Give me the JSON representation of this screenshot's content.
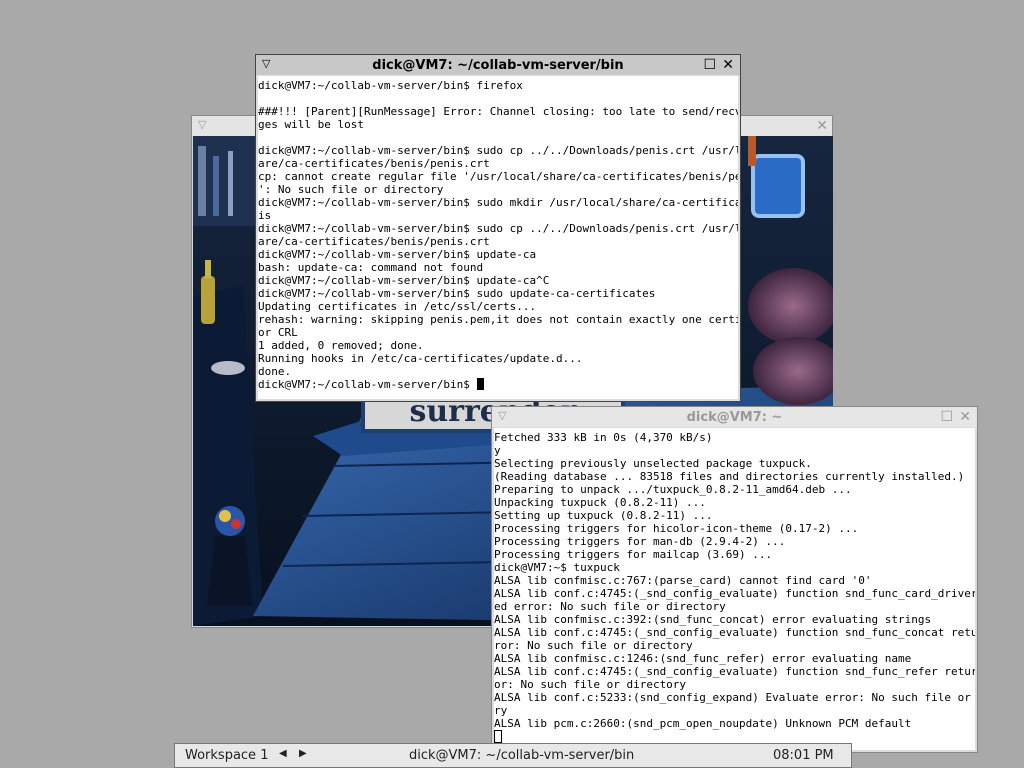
{
  "game_window": {
    "menu_icon": "chevron-down-icon",
    "close_icon": "close-icon",
    "scene_text": "surrender"
  },
  "terminal1": {
    "title": "dick@VM7: ~/collab-vm-server/bin",
    "menu_icon": "chevron-down-icon",
    "maximize_icon": "square-icon",
    "close_icon": "close-icon",
    "lines": [
      "dick@VM7:~/collab-vm-server/bin$ firefox",
      "",
      "###!!! [Parent][RunMessage] Error: Channel closing: too late to send/recv, messa",
      "ges will be lost",
      "",
      "dick@VM7:~/collab-vm-server/bin$ sudo cp ../../Downloads/penis.crt /usr/local/sh",
      "are/ca-certificates/benis/penis.crt",
      "cp: cannot create regular file '/usr/local/share/ca-certificates/benis/penis.crt",
      "': No such file or directory",
      "dick@VM7:~/collab-vm-server/bin$ sudo mkdir /usr/local/share/ca-certificates/ben",
      "is",
      "dick@VM7:~/collab-vm-server/bin$ sudo cp ../../Downloads/penis.crt /usr/local/sh",
      "are/ca-certificates/benis/penis.crt",
      "dick@VM7:~/collab-vm-server/bin$ update-ca",
      "bash: update-ca: command not found",
      "dick@VM7:~/collab-vm-server/bin$ update-ca^C",
      "dick@VM7:~/collab-vm-server/bin$ sudo update-ca-certificates",
      "Updating certificates in /etc/ssl/certs...",
      "rehash: warning: skipping penis.pem,it does not contain exactly one certificate",
      "or CRL",
      "1 added, 0 removed; done.",
      "Running hooks in /etc/ca-certificates/update.d...",
      "done.",
      "dick@VM7:~/collab-vm-server/bin$ "
    ]
  },
  "terminal2": {
    "title": "dick@VM7: ~",
    "maximize_icon": "square-icon",
    "close_icon": "close-icon",
    "lines": [
      "Fetched 333 kB in 0s (4,370 kB/s)",
      "y",
      "Selecting previously unselected package tuxpuck.",
      "(Reading database ... 83518 files and directories currently installed.)",
      "Preparing to unpack .../tuxpuck_0.8.2-11_amd64.deb ...",
      "Unpacking tuxpuck (0.8.2-11) ...",
      "Setting up tuxpuck (0.8.2-11) ...",
      "Processing triggers for hicolor-icon-theme (0.17-2) ...",
      "Processing triggers for man-db (2.9.4-2) ...",
      "Processing triggers for mailcap (3.69) ...",
      "dick@VM7:~$ tuxpuck",
      "ALSA lib confmisc.c:767:(parse_card) cannot find card '0'",
      "ALSA lib conf.c:4745:(_snd_config_evaluate) function snd_func_card_driver return",
      "ed error: No such file or directory",
      "ALSA lib confmisc.c:392:(snd_func_concat) error evaluating strings",
      "ALSA lib conf.c:4745:(_snd_config_evaluate) function snd_func_concat returned er",
      "ror: No such file or directory",
      "ALSA lib confmisc.c:1246:(snd_func_refer) error evaluating name",
      "ALSA lib conf.c:4745:(_snd_config_evaluate) function snd_func_refer returned err",
      "or: No such file or directory",
      "ALSA lib conf.c:5233:(snd_config_expand) Evaluate error: No such file or directo",
      "ry",
      "ALSA lib pcm.c:2660:(snd_pcm_open_noupdate) Unknown PCM default",
      ""
    ]
  },
  "taskbar": {
    "workspace": "Workspace 1",
    "prev_icon": "triangle-left-icon",
    "next_icon": "triangle-right-icon",
    "task_title": "dick@VM7: ~/collab-vm-server/bin",
    "clock": "08:01 PM"
  }
}
